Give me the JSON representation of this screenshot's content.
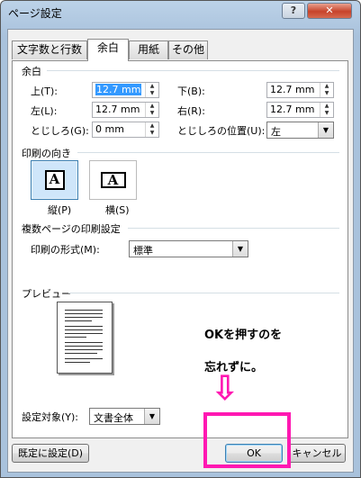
{
  "window": {
    "title": "ページ設定",
    "help_label": "?",
    "close_label": "✕"
  },
  "tabs": [
    "文字数と行数",
    "余白",
    "用紙",
    "その他"
  ],
  "margins": {
    "group_label": "余白",
    "top_label": "上(T):",
    "top_value": "12.7 mm",
    "bottom_label": "下(B):",
    "bottom_value": "12.7 mm",
    "left_label": "左(L):",
    "left_value": "12.7 mm",
    "right_label": "右(R):",
    "right_value": "12.7 mm",
    "gutter_label": "とじしろ(G):",
    "gutter_value": "0 mm",
    "gutter_pos_label": "とじしろの位置(U):",
    "gutter_pos_value": "左"
  },
  "orientation": {
    "group_label": "印刷の向き",
    "portrait_label": "縦(P)",
    "landscape_label": "横(S)",
    "glyph": "A"
  },
  "pages": {
    "group_label": "複数ページの印刷設定",
    "format_label": "印刷の形式(M):",
    "format_value": "標準"
  },
  "preview": {
    "group_label": "プレビュー",
    "apply_label": "設定対象(Y):",
    "apply_value": "文書全体"
  },
  "annotation": {
    "line1": "OKを押すのを",
    "line2": "忘れずに。",
    "arrow": "⇩"
  },
  "buttons": {
    "default": "既定に設定(D)",
    "ok": "OK",
    "cancel": "キャンセル"
  },
  "colors": {
    "highlight": "#ff18b2",
    "selection": "#3399ff"
  }
}
